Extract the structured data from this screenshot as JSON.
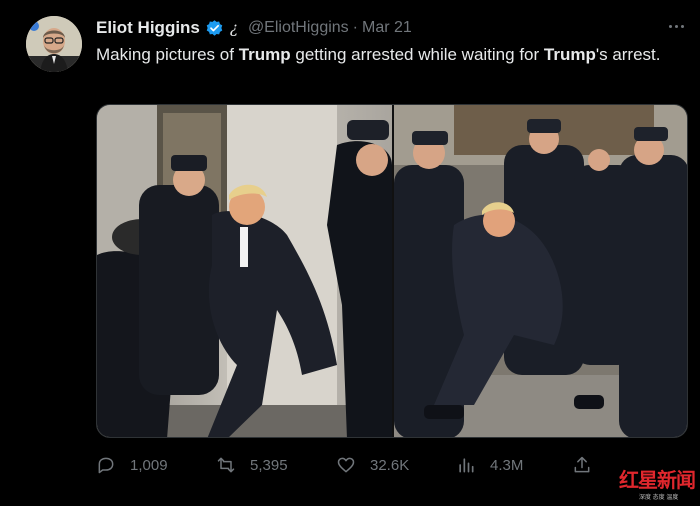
{
  "author": {
    "display_name": "Eliot Higgins",
    "handle": "@EliotHiggins",
    "separator": "·",
    "date": "Mar 21",
    "affiliation_glyph": "¿"
  },
  "tweet": {
    "text_parts": [
      {
        "text": "Making pictures of ",
        "bold": false
      },
      {
        "text": "Trump",
        "bold": true
      },
      {
        "text": " getting arrested while waiting for ",
        "bold": false
      },
      {
        "text": "Trump",
        "bold": true
      },
      {
        "text": "'s arrest.",
        "bold": false
      }
    ]
  },
  "media": {
    "images": [
      {
        "name": "ai-image-arrest-left"
      },
      {
        "name": "ai-image-arrest-right"
      }
    ]
  },
  "actions": {
    "reply": {
      "icon": "reply-icon",
      "count": "1,009"
    },
    "retweet": {
      "icon": "retweet-icon",
      "count": "5,395"
    },
    "like": {
      "icon": "heart-icon",
      "count": "32.6K"
    },
    "views": {
      "icon": "views-icon",
      "count": "4.3M"
    },
    "share": {
      "icon": "share-icon"
    }
  },
  "watermark": {
    "title": "红星新闻",
    "subtitle": "深度 态度 温度"
  },
  "colors": {
    "background": "#000000",
    "text": "#e7e9ea",
    "muted": "#71767b",
    "verified": "#1d9bf0",
    "watermark": "#e0272d"
  }
}
